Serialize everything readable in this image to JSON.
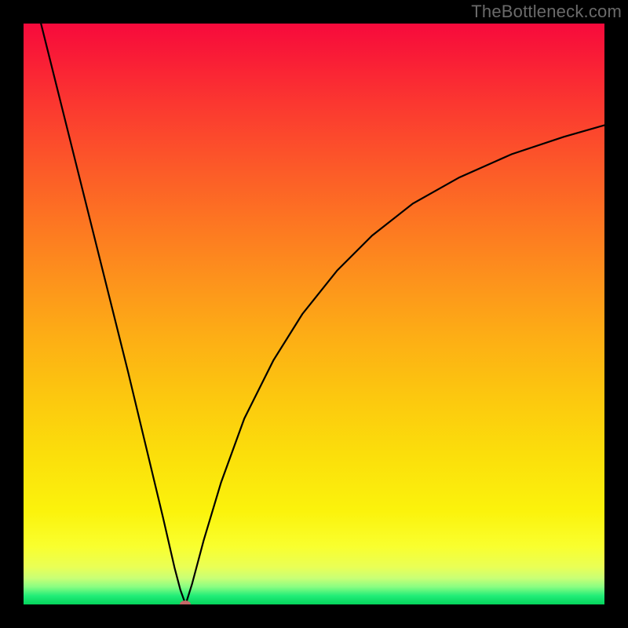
{
  "attribution": "TheBottleneck.com",
  "chart_data": {
    "type": "line",
    "title": "",
    "xlabel": "",
    "ylabel": "",
    "xlim": [
      0,
      100
    ],
    "ylim": [
      0,
      100
    ],
    "series": [
      {
        "name": "bottleneck-curve",
        "x": [
          3,
          6,
          9,
          12,
          15,
          18,
          21,
          24,
          26,
          27,
          27.9,
          29,
          31,
          34,
          38,
          43,
          48,
          54,
          60,
          67,
          75,
          84,
          93,
          100
        ],
        "y": [
          100,
          88,
          76,
          64,
          52,
          40,
          27.5,
          15,
          6.3,
          2.5,
          0,
          3.5,
          11,
          21,
          32,
          42,
          50,
          57.5,
          63.5,
          69,
          73.5,
          77.5,
          80.5,
          82.5
        ]
      }
    ],
    "marker": {
      "x": 27.9,
      "y": 0
    },
    "background_gradient": {
      "top": "#f70a3c",
      "mid": "#fdae15",
      "bottom": "#04d45c"
    }
  }
}
